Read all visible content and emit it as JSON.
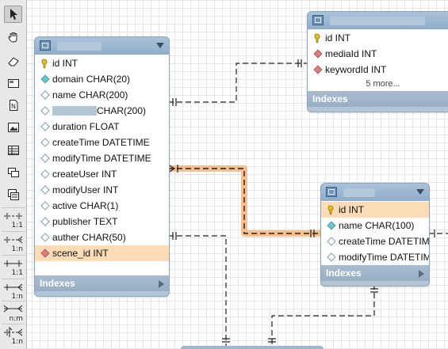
{
  "toolbar": {
    "tools": [
      "pointer-tool",
      "hand-tool",
      "eraser-tool",
      "layer-tool",
      "note-tool",
      "image-tool",
      "table-tool",
      "view-tool",
      "routine-tool"
    ],
    "relationships": [
      "1:1",
      "1:n",
      "1:1",
      "1:n",
      "n:m",
      "1:n"
    ]
  },
  "tables": {
    "left": {
      "columns": [
        {
          "label": "id INT",
          "icon": "key-icon"
        },
        {
          "label": "domain CHAR(20)",
          "icon": "filled-diamond-icon"
        },
        {
          "label": "name CHAR(200)",
          "icon": "diamond-icon"
        },
        {
          "label": "CHAR(200)",
          "icon": "diamond-icon",
          "redacted_prefix": true
        },
        {
          "label": "duration FLOAT",
          "icon": "diamond-icon"
        },
        {
          "label": "createTime DATETIME",
          "icon": "diamond-icon"
        },
        {
          "label": "modifyTime DATETIME",
          "icon": "diamond-icon"
        },
        {
          "label": "createUser INT",
          "icon": "diamond-icon"
        },
        {
          "label": "modifyUser INT",
          "icon": "diamond-icon"
        },
        {
          "label": "active CHAR(1)",
          "icon": "diamond-icon"
        },
        {
          "label": "publisher TEXT",
          "icon": "diamond-icon"
        },
        {
          "label": "auther CHAR(50)",
          "icon": "diamond-icon"
        },
        {
          "label": "scene_id INT",
          "icon": "fk-diamond-icon",
          "highlighted": true
        }
      ],
      "footer": "Indexes"
    },
    "top_right": {
      "columns": [
        {
          "label": "id INT",
          "icon": "key-icon"
        },
        {
          "label": "mediaId INT",
          "icon": "fk-diamond-icon"
        },
        {
          "label": "keywordId INT",
          "icon": "fk-diamond-icon"
        }
      ],
      "more": "5 more...",
      "footer": "Indexes"
    },
    "middle_right": {
      "columns": [
        {
          "label": "id INT",
          "icon": "key-icon",
          "highlighted": true
        },
        {
          "label": "name CHAR(100)",
          "icon": "filled-diamond-icon"
        },
        {
          "label": "createTime DATETIME",
          "icon": "diamond-icon"
        },
        {
          "label": "modifyTime DATETIME",
          "icon": "diamond-icon"
        }
      ],
      "footer": "Indexes"
    }
  },
  "colors": {
    "header": "#9db7d0",
    "highlight_row": "#fbdcb6",
    "selected_connector": "#f2a65a",
    "canvas_grid": "#e6e6e6"
  }
}
